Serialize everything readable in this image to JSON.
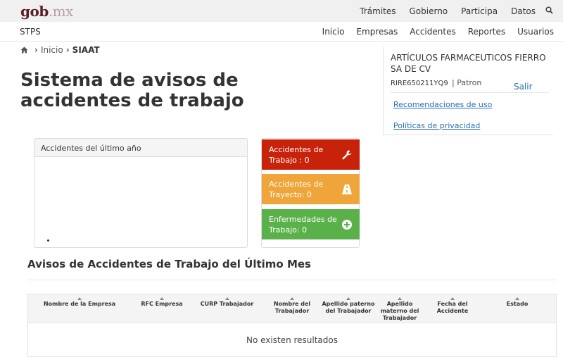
{
  "topbar": {
    "logo_main": "gob",
    "logo_ext": ".mx",
    "links": [
      "Trámites",
      "Gobierno",
      "Participa",
      "Datos"
    ],
    "search_icon": "search-icon"
  },
  "stps": {
    "title": "STPS",
    "nav": [
      "Inicio",
      "Empresas",
      "Accidentes",
      "Reportes",
      "Usuarios"
    ]
  },
  "breadcrumb": {
    "home_icon": "home-icon",
    "items": [
      "Inicio",
      "SIAAT"
    ]
  },
  "page_title": "Sistema de avisos de accidentes de trabajo",
  "user": {
    "company": "ARTÍCULOS FARMACEUTICOS FIERRO SA DE CV",
    "rfc": "RIRE650211YQ9",
    "role": "| Patron",
    "logout": "Salir",
    "links": [
      "Recomendaciones de uso",
      "Políticas de privacidad"
    ]
  },
  "chart_panel": {
    "title": "Accidentes del último año"
  },
  "tiles": [
    {
      "label": "Accidentes de Trabajo : 0",
      "icon": "wrench-icon",
      "color": "#c9220b"
    },
    {
      "label": "Accidentes de Trayecto: 0",
      "icon": "road-icon",
      "color": "#f0a53a"
    },
    {
      "label": "Enfermedades de Trabajo: 0",
      "icon": "plus-circle-icon",
      "color": "#5ab14a"
    }
  ],
  "section_title": "Avisos de Accidentes de Trabajo del Último Mes",
  "table": {
    "headers": [
      "Nombre de la Empresa",
      "RFC Empresa",
      "CURP Trabajador",
      "Nombre del Trabajador",
      "Apellido paterno del Trabajador",
      "Apellido materno del Trabajador",
      "Fecha del Accidente",
      "Estado"
    ],
    "empty_message": "No existen resultados"
  }
}
